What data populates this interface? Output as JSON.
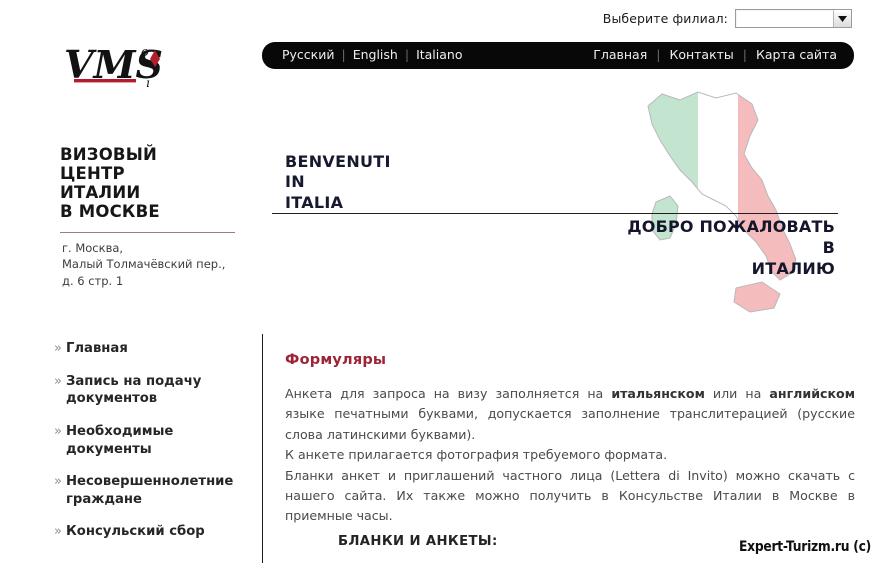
{
  "branch_bar": {
    "label": "Выберите филиал:",
    "select_value": "",
    "select_placeholder": "",
    "arrow_icon": "chevron-down-icon"
  },
  "navbar": {
    "languages": [
      {
        "label": "Русский"
      },
      {
        "label": "English"
      },
      {
        "label": "Italiano"
      }
    ],
    "links": [
      {
        "label": "Главная"
      },
      {
        "label": "Контакты"
      },
      {
        "label": "Карта сайта"
      }
    ],
    "separator": "|",
    "background": "#080808",
    "text_color": "#efefef"
  },
  "logo": {
    "text": "VMS",
    "accent_color": "#b21d2a",
    "name": "vms-logo"
  },
  "sidebar": {
    "title": "ВИЗОВЫЙ\nЦЕНТР\nИТАЛИИ\nВ МОСКВЕ",
    "title_lines": [
      "ВИЗОВЫЙ",
      "ЦЕНТР",
      "ИТАЛИИ",
      "В МОСКВЕ"
    ],
    "address_lines": [
      "г. Москва,",
      "Малый Толмачёвский пер.,",
      "д. 6 стр. 1"
    ],
    "menu": [
      {
        "label": "Главная",
        "icon": "chevron-right-icon"
      },
      {
        "label": "Запись на подачу документов",
        "icon": "chevron-right-icon"
      },
      {
        "label": "Необходимые документы",
        "icon": "chevron-right-icon"
      },
      {
        "label": "Несовершеннолетние граждане",
        "icon": "chevron-right-icon"
      },
      {
        "label": "Консульский сбор",
        "icon": "chevron-right-icon"
      }
    ]
  },
  "hero": {
    "benvenuti_lines": [
      "BENVENUTI",
      "IN",
      "ITALIA"
    ],
    "welcome_lines": [
      "ДОБРО ПОЖАЛОВАТЬ",
      "В",
      "ИТАЛИЮ"
    ],
    "map_icon": "italy-map-icon",
    "map_colors": {
      "green": "#bfe3cc",
      "white": "#ffffff",
      "red": "#f4bcbc"
    }
  },
  "content": {
    "heading": "Формуляры",
    "heading_color": "#9d2436",
    "paragraph_1_a": "Анкета для запроса на визу заполняется на ",
    "paragraph_1_bold_1": "итальянском",
    "paragraph_1_b": " или на ",
    "paragraph_1_bold_2": "английском",
    "paragraph_1_c": " языке печатными буквами, допускается заполнение транслитерацией (русские слова латинскими буквами).",
    "line_2": "К анкете прилагается фотография требуемого формата.",
    "line_3": "Бланки анкет и приглашений частного лица (Lettera di Invito) можно скачать с нашего сайта. Их также можно получить в Консульстве Италии в Москве в приемные часы.",
    "forms_heading": "БЛАНКИ И АНКЕТЫ:"
  },
  "watermark": {
    "text": "Expert-Turizm.ru (c)"
  }
}
